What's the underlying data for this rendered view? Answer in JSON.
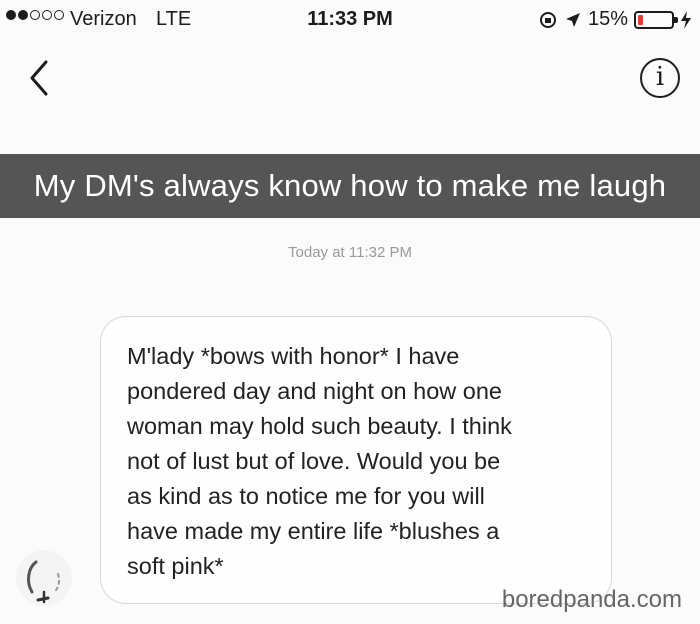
{
  "status_bar": {
    "carrier": "Verizon",
    "network": "LTE",
    "time": "11:33 PM",
    "battery": "15%",
    "signal_bars": 2,
    "battery_level": 0.15,
    "battery_color": "#e43b3b"
  },
  "nav": {
    "back_icon": "chevron-left-icon",
    "info_label": "i"
  },
  "caption": "My DM's always know how to make me laugh",
  "conversation": {
    "timestamp": "Today at 11:32 PM",
    "message": "M'lady *bows with honor* I have\npondered day and night on how one\nwoman may hold such beauty. I think\nnot of lust but of love. Would you be\nas kind as to notice me for you will\nhave made my entire life *blushes a\nsoft pink*"
  },
  "watermark": "boredpanda.com"
}
